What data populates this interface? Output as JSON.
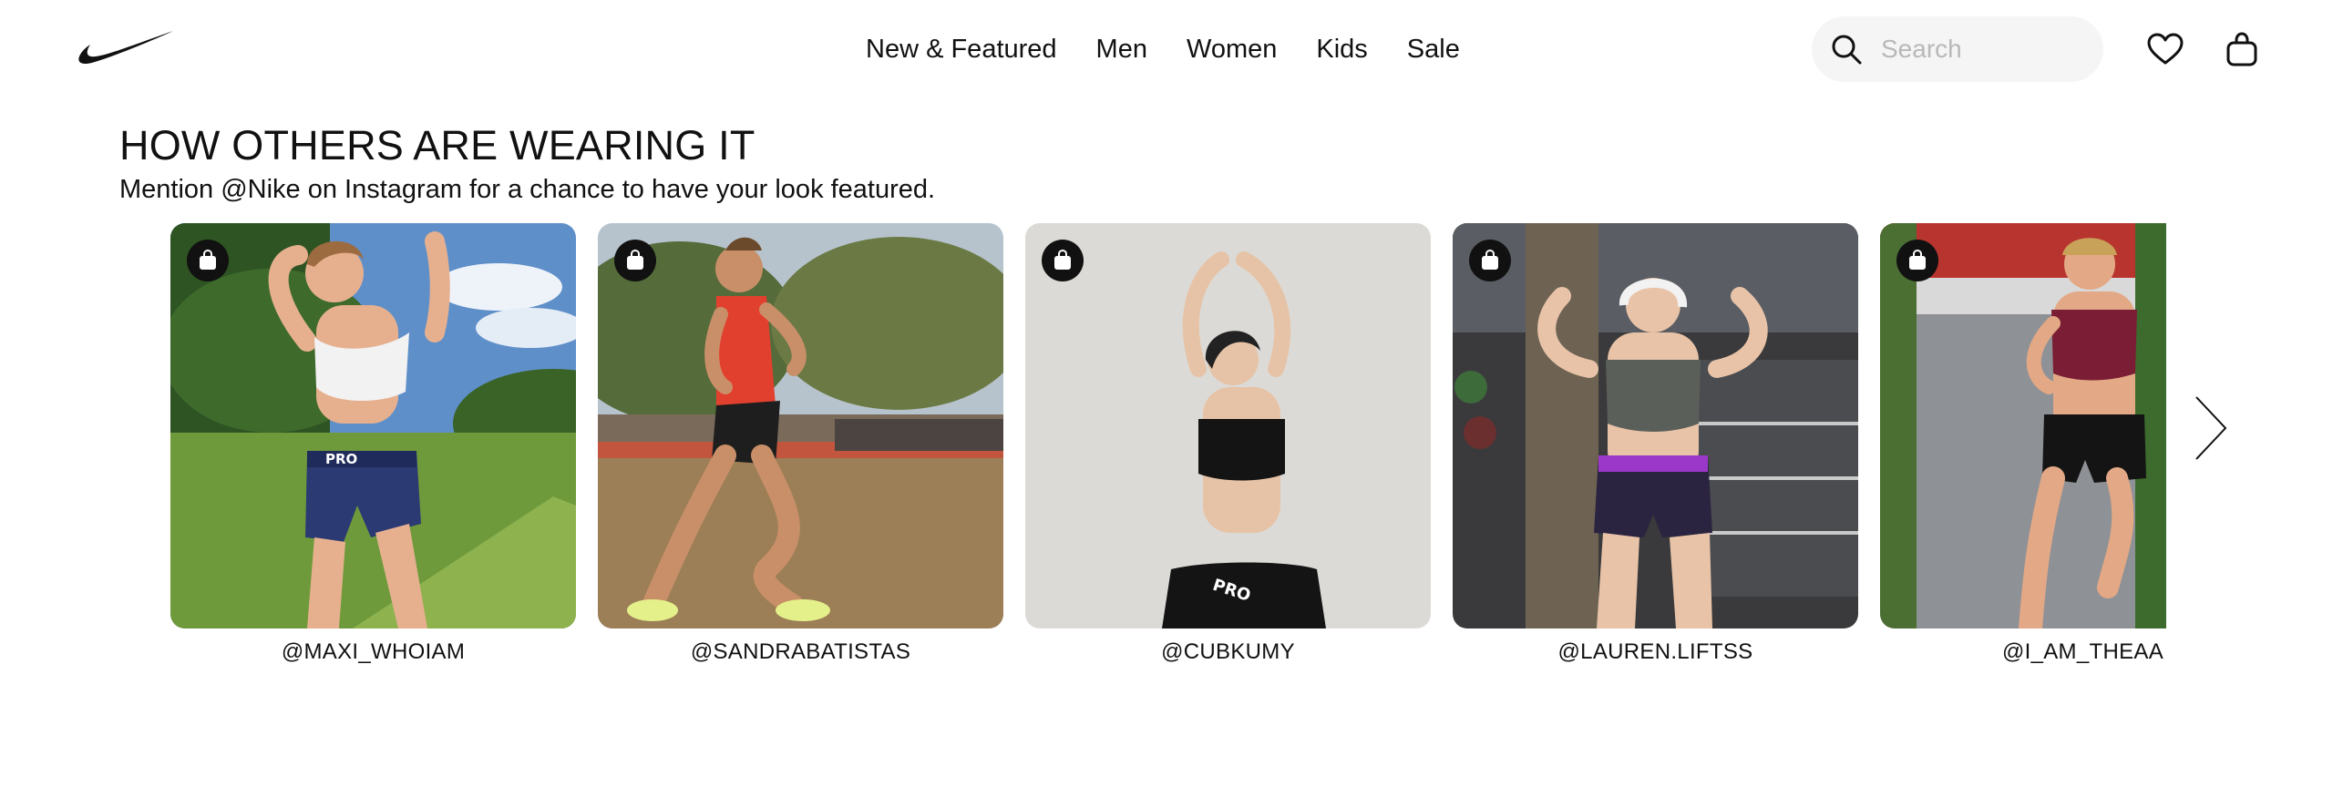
{
  "header": {
    "logo": "nike-swoosh",
    "nav": [
      {
        "label": "New & Featured"
      },
      {
        "label": "Men"
      },
      {
        "label": "Women"
      },
      {
        "label": "Kids"
      },
      {
        "label": "Sale"
      }
    ],
    "search": {
      "placeholder": "Search",
      "value": ""
    },
    "icons": [
      "search-icon",
      "heart-icon",
      "bag-icon"
    ]
  },
  "section": {
    "title": "HOW OTHERS ARE WEARING IT",
    "subtitle": "Mention @Nike on Instagram for a chance to have your look featured.",
    "cards": [
      {
        "handle": "@MAXI_WHOIAM"
      },
      {
        "handle": "@SANDRABATISTAS"
      },
      {
        "handle": "@CUBKUMY"
      },
      {
        "handle": "@LAUREN.LIFTSS"
      },
      {
        "handle": "@I_AM_THEAA"
      }
    ],
    "card_icon": "shopping-bag-icon",
    "next_icon": "chevron-right-icon"
  },
  "colors": {
    "text": "#111111",
    "search_bg": "#f5f5f5",
    "placeholder": "#b8b8b8"
  }
}
